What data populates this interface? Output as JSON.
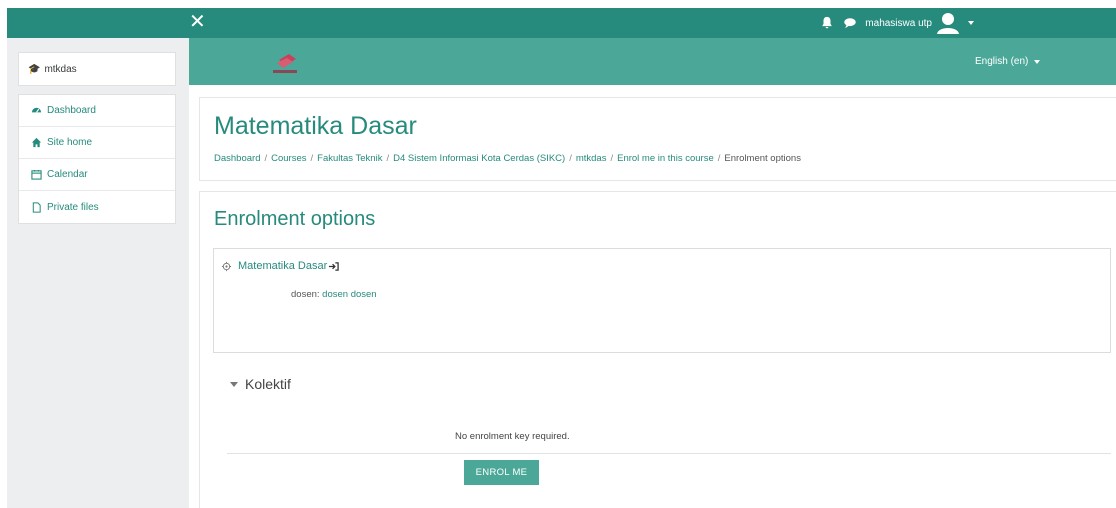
{
  "topbar": {
    "close_glyph": "✕",
    "username": "mahasiswa utp",
    "icons": [
      "bell-icon",
      "chat-icon",
      "avatar-icon",
      "caret-down-icon"
    ]
  },
  "sidebar": {
    "course_short": "mtkdas",
    "items": [
      {
        "label": "Dashboard",
        "icon": "dashboard-icon"
      },
      {
        "label": "Site home",
        "icon": "home-icon"
      },
      {
        "label": "Calendar",
        "icon": "calendar-icon"
      },
      {
        "label": "Private files",
        "icon": "file-icon"
      }
    ]
  },
  "header": {
    "language": "English (en)"
  },
  "page": {
    "title": "Matematika Dasar",
    "breadcrumb": [
      "Dashboard",
      "Courses",
      "Fakultas Teknik",
      "D4 Sistem Informasi Kota Cerdas (SIKC)",
      "mtkdas",
      "Enrol me in this course",
      "Enrolment options"
    ],
    "breadcrumb_sep": "/"
  },
  "enrolment": {
    "heading": "Enrolment options",
    "course_name": "Matematika Dasar",
    "teacher_role": "dosen:",
    "teacher_name": "dosen dosen",
    "method_name": "Kolektif",
    "no_key_text": "No enrolment key required.",
    "enrol_button": "ENROL ME"
  },
  "colors": {
    "brand": "#268b7d",
    "header_band": "#4ba899",
    "sidebar_bg": "#eceeef"
  }
}
